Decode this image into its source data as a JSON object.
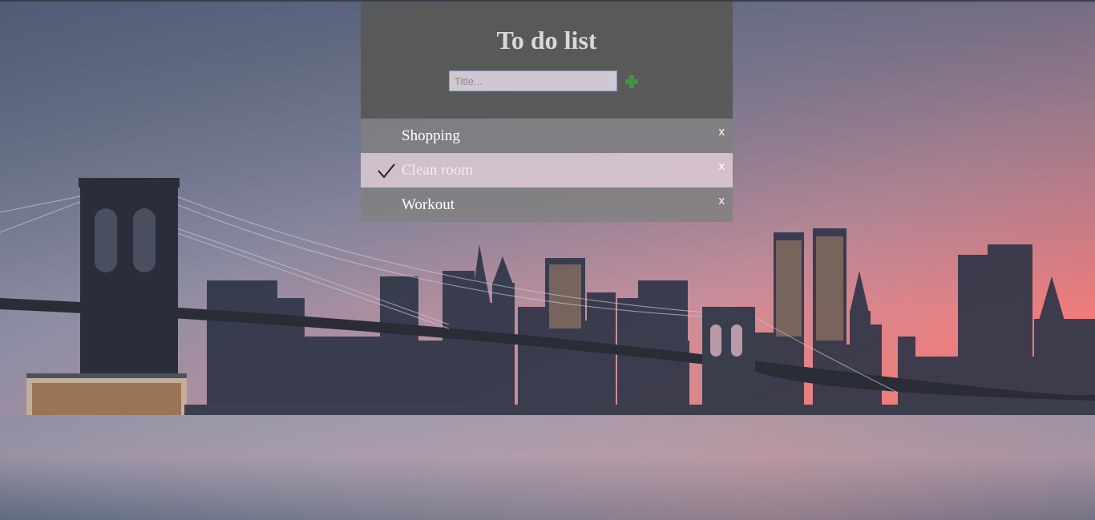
{
  "app": {
    "title": "To do list"
  },
  "input": {
    "placeholder": "Title...",
    "value": ""
  },
  "add_button": {
    "icon": "plus-icon",
    "color": "#3a9a3a"
  },
  "items": [
    {
      "label": "Shopping",
      "checked": false,
      "close_label": "x"
    },
    {
      "label": "Clean room",
      "checked": true,
      "close_label": "x"
    },
    {
      "label": "Workout",
      "checked": false,
      "close_label": "x"
    }
  ],
  "colors": {
    "header_bg": "#585858",
    "item_bg": "#808080",
    "checked_item_bg": "#e2d0d8",
    "input_bg": "#cfc8d2",
    "input_border": "#8f9fc9"
  },
  "background": {
    "kind": "photo",
    "description_icon": "city-skyline-photo"
  }
}
